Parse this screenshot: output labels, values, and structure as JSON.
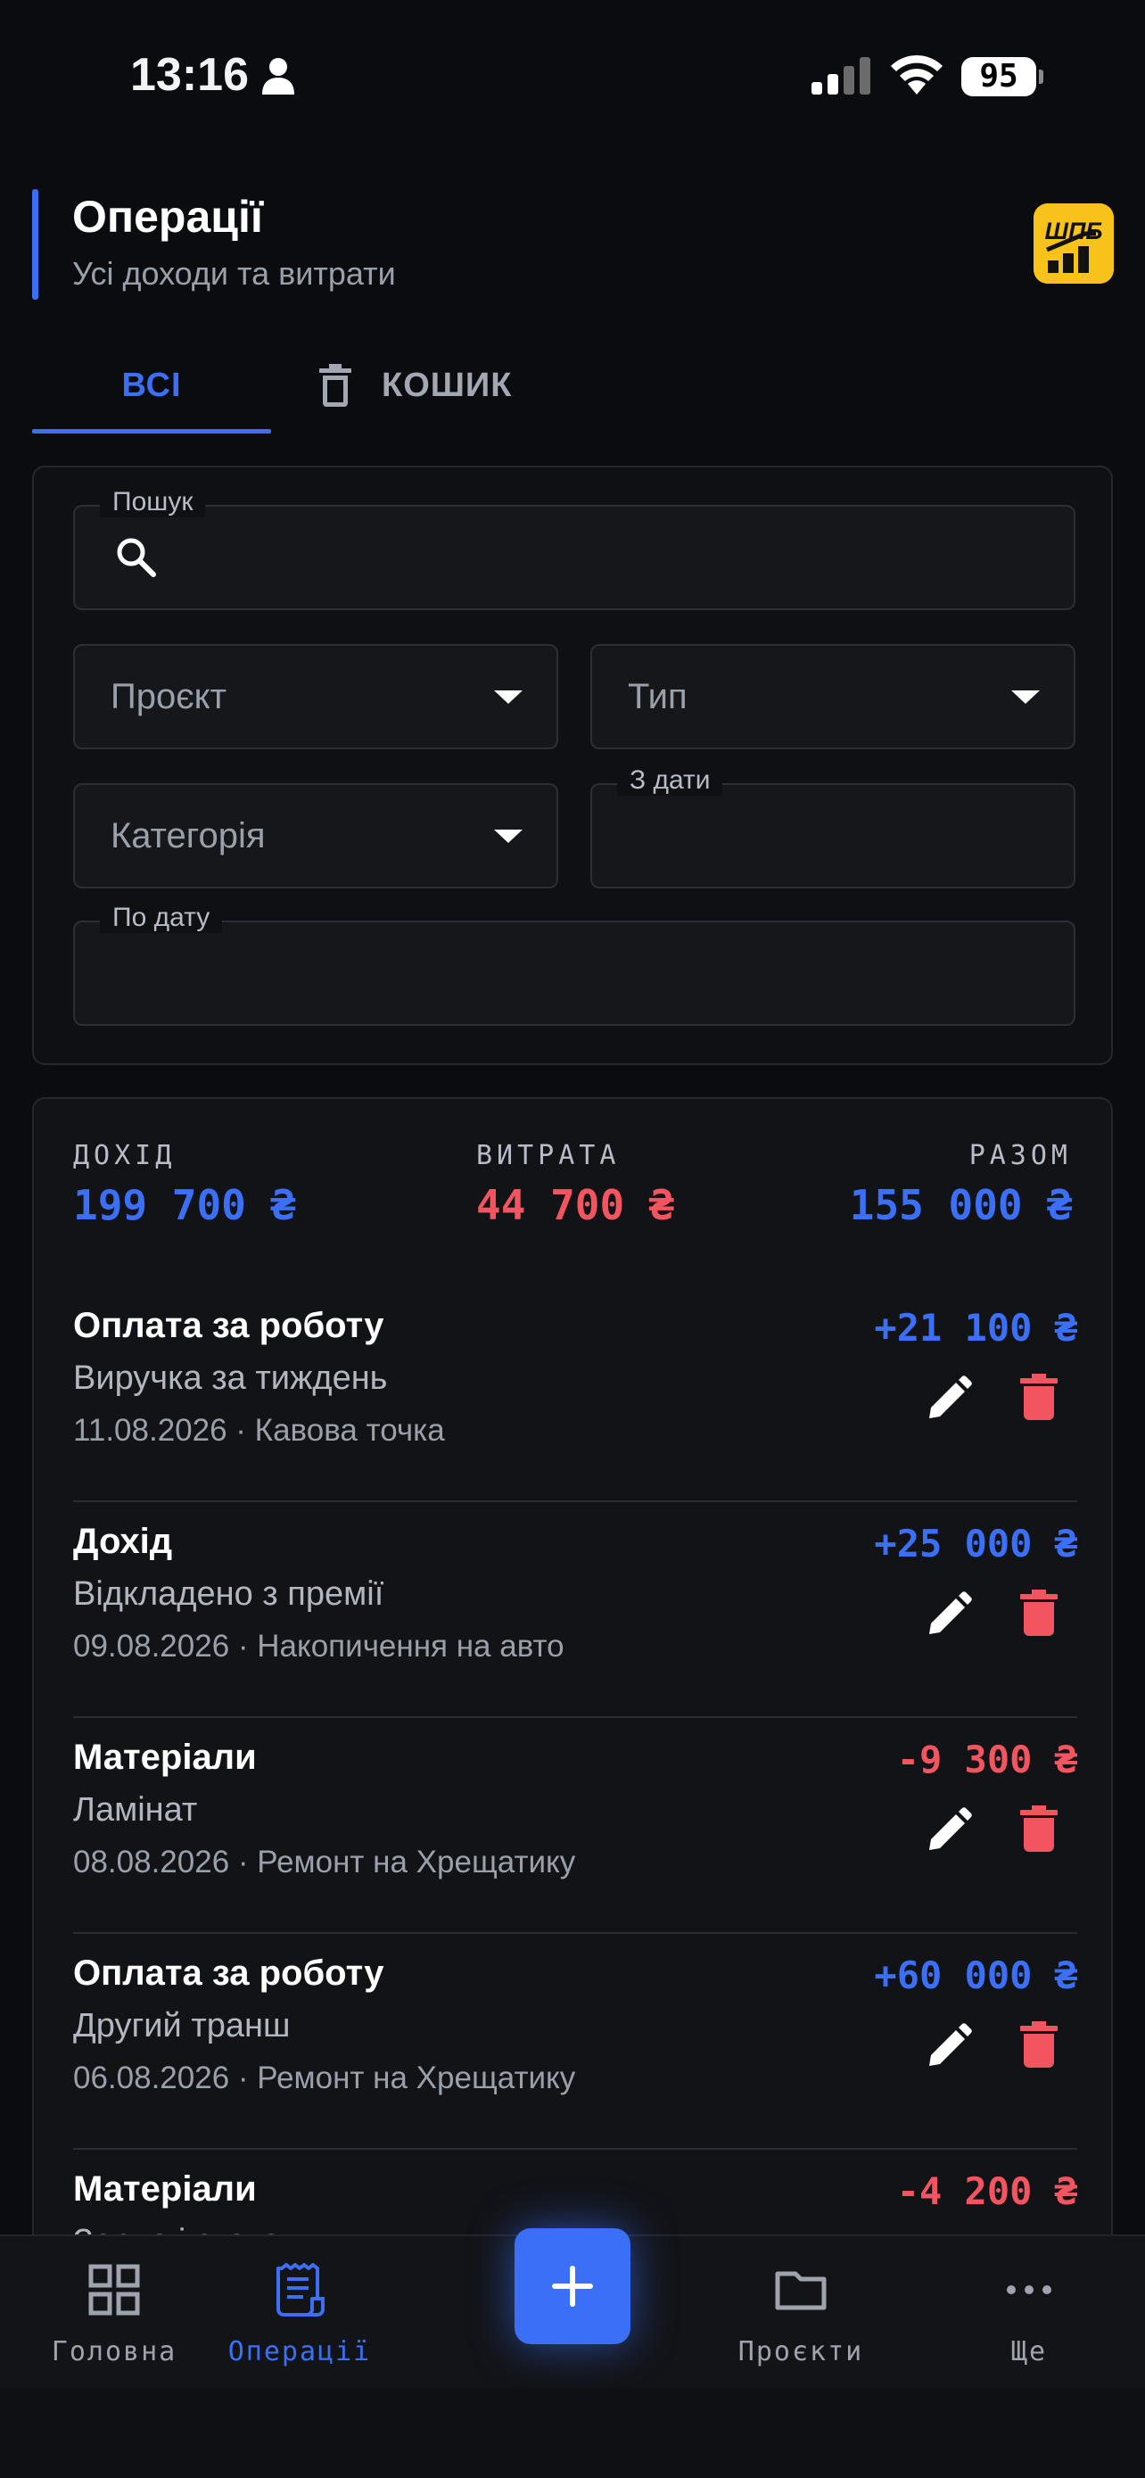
{
  "status_bar": {
    "time": "13:16",
    "battery": "95"
  },
  "header": {
    "title": "Операції",
    "subtitle": "Усі доходи та витрати",
    "logo_text": "ШПБ"
  },
  "tabs": {
    "all": "ВСІ",
    "trash": "КОШИК"
  },
  "filters": {
    "search_label": "Пошук",
    "project_placeholder": "Проєкт",
    "type_placeholder": "Тип",
    "category_placeholder": "Категорія",
    "date_from_label": "З дати",
    "date_to_label": "По дату"
  },
  "summary": {
    "income_label": "ДОХІД",
    "income_value": "199 700 ₴",
    "expense_label": "ВИТРАТА",
    "expense_value": "44 700 ₴",
    "total_label": "РАЗОМ",
    "total_value": "155 000 ₴"
  },
  "operations": [
    {
      "title": "Оплата за роботу",
      "description": "Виручка за тиждень",
      "meta": "11.08.2026 · Кавова точка",
      "amount": "+21 100 ₴",
      "kind": "income"
    },
    {
      "title": "Дохід",
      "description": "Відкладено з премії",
      "meta": "09.08.2026 · Накопичення на авто",
      "amount": "+25 000 ₴",
      "kind": "income"
    },
    {
      "title": "Матеріали",
      "description": "Ламінат",
      "meta": "08.08.2026 · Ремонт на Хрещатику",
      "amount": "-9 300 ₴",
      "kind": "expense"
    },
    {
      "title": "Оплата за роботу",
      "description": "Другий транш",
      "meta": "06.08.2026 · Ремонт на Хрещатику",
      "amount": "+60 000 ₴",
      "kind": "income"
    },
    {
      "title": "Матеріали",
      "description": "Зерно і стакани",
      "meta": "",
      "amount": "-4 200 ₴",
      "kind": "expense"
    }
  ],
  "nav": {
    "home": "Головна",
    "operations": "Операції",
    "projects": "Проєкти",
    "more": "Ще"
  },
  "colors": {
    "accent": "#3b6ff6",
    "expense": "#f2555f",
    "logo": "#f7c31a"
  }
}
